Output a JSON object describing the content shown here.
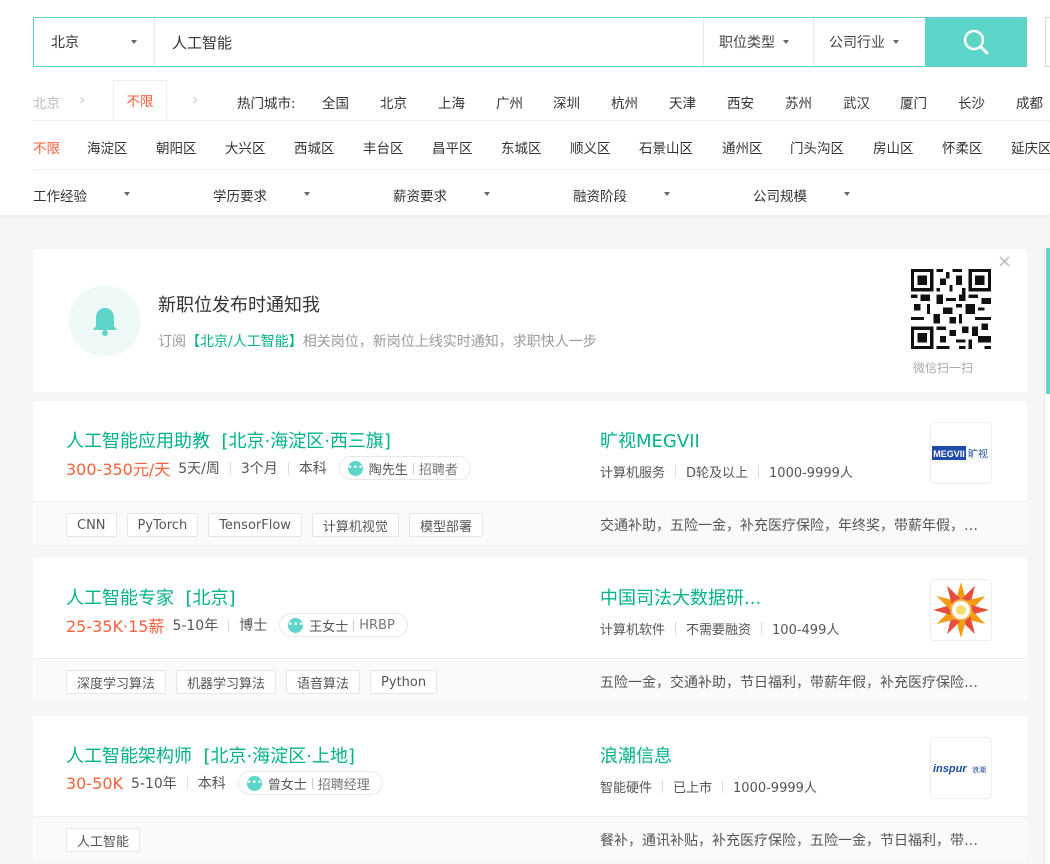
{
  "search": {
    "city": "北京",
    "query": "人工智能",
    "job_type": "职位类型",
    "industry": "公司行业"
  },
  "city_row": {
    "province": "北京",
    "selected": "不限",
    "hot_label": "热门城市:",
    "cities": [
      "全国",
      "北京",
      "上海",
      "广州",
      "深圳",
      "杭州",
      "天津",
      "西安",
      "苏州",
      "武汉",
      "厦门",
      "长沙",
      "成都"
    ]
  },
  "districts": [
    "不限",
    "海淀区",
    "朝阳区",
    "大兴区",
    "西城区",
    "丰台区",
    "昌平区",
    "东城区",
    "顺义区",
    "石景山区",
    "通州区",
    "门头沟区",
    "房山区",
    "怀柔区",
    "延庆区"
  ],
  "filters": [
    "工作经验",
    "学历要求",
    "薪资要求",
    "融资阶段",
    "公司规模"
  ],
  "notify": {
    "title": "新职位发布时通知我",
    "sub_pre": "订阅",
    "sub_hl": "【北京/人工智能】",
    "sub_post": "相关岗位，新岗位上线实时通知，求职快人一步",
    "qr_caption": "微信扫一扫",
    "close": "×"
  },
  "jobs": [
    {
      "title": "人工智能应用助教",
      "location": "[北京·海淀区·西三旗]",
      "salary": "300-350元/天",
      "meta": [
        "5天/周",
        "3个月",
        "本科"
      ],
      "recruiter": "陶先生",
      "recruiter_role": "招聘者",
      "company": "旷视MEGVII",
      "company_meta": [
        "计算机服务",
        "D轮及以上",
        "1000-9999人"
      ],
      "logo": "megvii",
      "tags": [
        "CNN",
        "PyTorch",
        "TensorFlow",
        "计算机视觉",
        "模型部署"
      ],
      "benefits": "交通补助，五险一金，补充医疗保险，年终奖，带薪年假，定期体检"
    },
    {
      "title": "人工智能专家",
      "location": "[北京]",
      "salary": "25-35K·15薪",
      "meta": [
        "5-10年",
        "博士"
      ],
      "recruiter": "王女士",
      "recruiter_role": "HRBP",
      "company": "中国司法大数据研...",
      "company_meta": [
        "计算机软件",
        "不需要融资",
        "100-499人"
      ],
      "logo": "sunflower",
      "tags": [
        "深度学习算法",
        "机器学习算法",
        "语音算法",
        "Python"
      ],
      "benefits": "五险一金，交通补助，节日福利，带薪年假，补充医疗保险，定期体检"
    },
    {
      "title": "人工智能架构师",
      "location": "[北京·海淀区·上地]",
      "salary": "30-50K",
      "meta": [
        "5-10年",
        "本科"
      ],
      "recruiter": "曾女士",
      "recruiter_role": "招聘经理",
      "company": "浪潮信息",
      "company_meta": [
        "智能硬件",
        "已上市",
        "1000-9999人"
      ],
      "logo": "inspur",
      "tags": [
        "人工智能"
      ],
      "benefits": "餐补，通讯补贴，补充医疗保险，五险一金，节日福利，带薪年假"
    }
  ],
  "colors": {
    "accent": "#5dd5c8",
    "brand_green": "#00b38a",
    "salary": "#fd5f39"
  },
  "icons": {
    "search": "magnifier-icon",
    "bell": "bell-icon",
    "close": "close-icon",
    "recruiter": "chat-bubble-icon"
  }
}
